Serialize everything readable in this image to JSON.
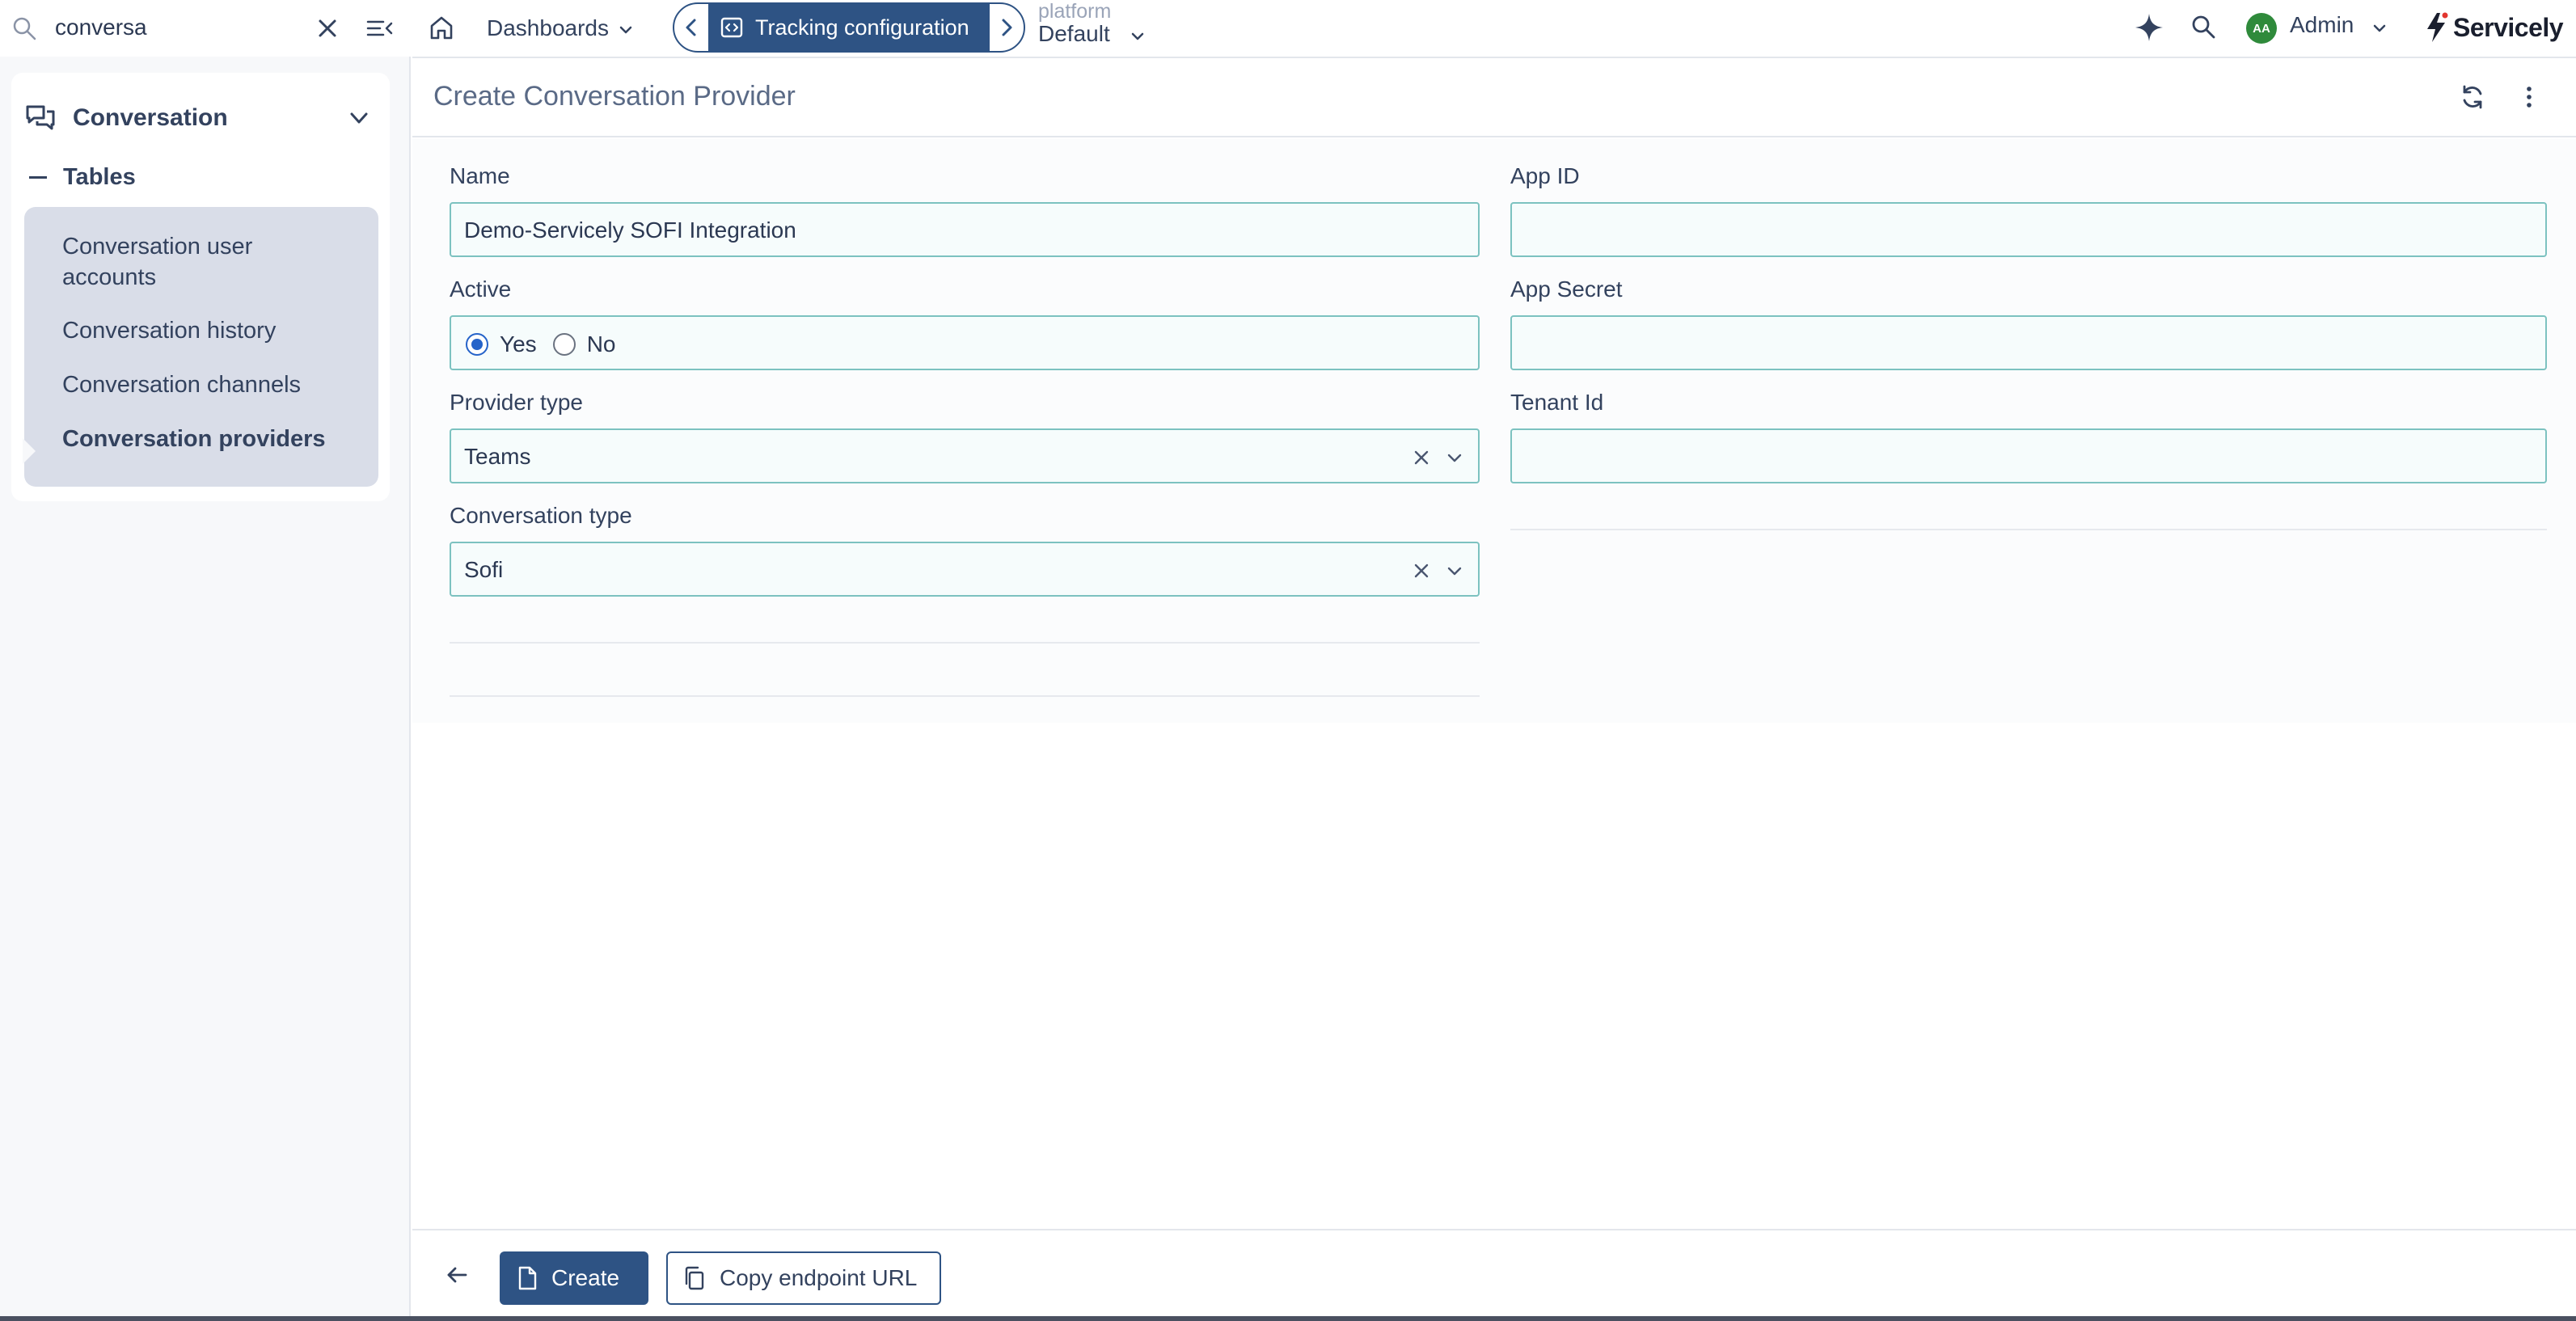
{
  "sidebar": {
    "search": {
      "value": "conversa"
    },
    "group": {
      "label": "Conversation"
    },
    "tables": {
      "label": "Tables",
      "items": [
        {
          "label": "Conversation user accounts"
        },
        {
          "label": "Conversation history"
        },
        {
          "label": "Conversation channels"
        },
        {
          "label": "Conversation providers"
        }
      ]
    }
  },
  "topbar": {
    "dashboards_label": "Dashboards",
    "tracking_label": "Tracking configuration",
    "platform_label": "platform",
    "platform_value": "Default",
    "user_initials": "AA",
    "user_label": "Admin",
    "logo_text": "Servicely"
  },
  "page": {
    "title": "Create Conversation Provider"
  },
  "form": {
    "name": {
      "label": "Name",
      "value": "Demo-Servicely SOFI Integration"
    },
    "active": {
      "label": "Active",
      "options": [
        "Yes",
        "No"
      ],
      "selected": "Yes"
    },
    "provider_type": {
      "label": "Provider type",
      "value": "Teams"
    },
    "conversation_type": {
      "label": "Conversation type",
      "value": "Sofi"
    },
    "app_id": {
      "label": "App ID",
      "value": ""
    },
    "app_secret": {
      "label": "App Secret",
      "value": ""
    },
    "tenant_id": {
      "label": "Tenant Id",
      "value": ""
    }
  },
  "footer": {
    "create_label": "Create",
    "copy_label": "Copy endpoint URL"
  },
  "colors": {
    "primary": "#2e5384",
    "field_border": "#7cc2c0",
    "avatar": "#2f8a3b",
    "sidebar_list_bg": "#d9dde8"
  },
  "icons": [
    "search-icon",
    "close-icon",
    "collapse-menu-icon",
    "chat-icon",
    "chevron-down-icon",
    "home-icon",
    "chevron-left-icon",
    "chevron-right-icon",
    "code-icon",
    "sparkle-icon",
    "refresh-icon",
    "more-vertical-icon",
    "arrow-left-icon",
    "document-icon",
    "copy-icon"
  ]
}
